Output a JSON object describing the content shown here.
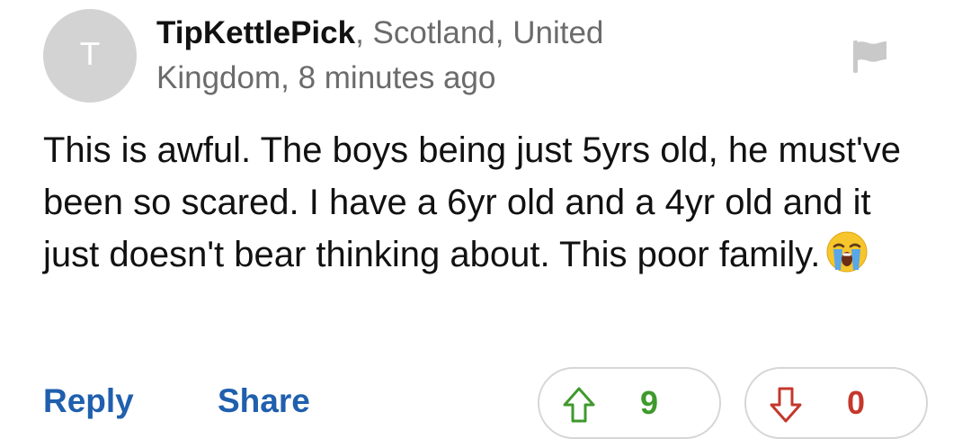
{
  "comment": {
    "avatar_letter": "T",
    "author": "TipKettlePick",
    "location_time": ", Scotland, United Kingdom, 8 minutes ago",
    "body": "This is awful. The boys being just 5yrs old, he must've been so scared. I have a 6yr old and a 4yr old and it just doesn't bear thinking about. This poor family.",
    "emoji_icon": "loudly-crying-face-icon"
  },
  "actions": {
    "reply_label": "Reply",
    "share_label": "Share"
  },
  "votes": {
    "upvotes": "9",
    "downvotes": "0"
  },
  "colors": {
    "link": "#1f5fae",
    "upvote": "#3f9a2c",
    "downvote": "#c5372c",
    "avatar_bg": "#d3d3d3",
    "flag": "#c9c9c9"
  }
}
